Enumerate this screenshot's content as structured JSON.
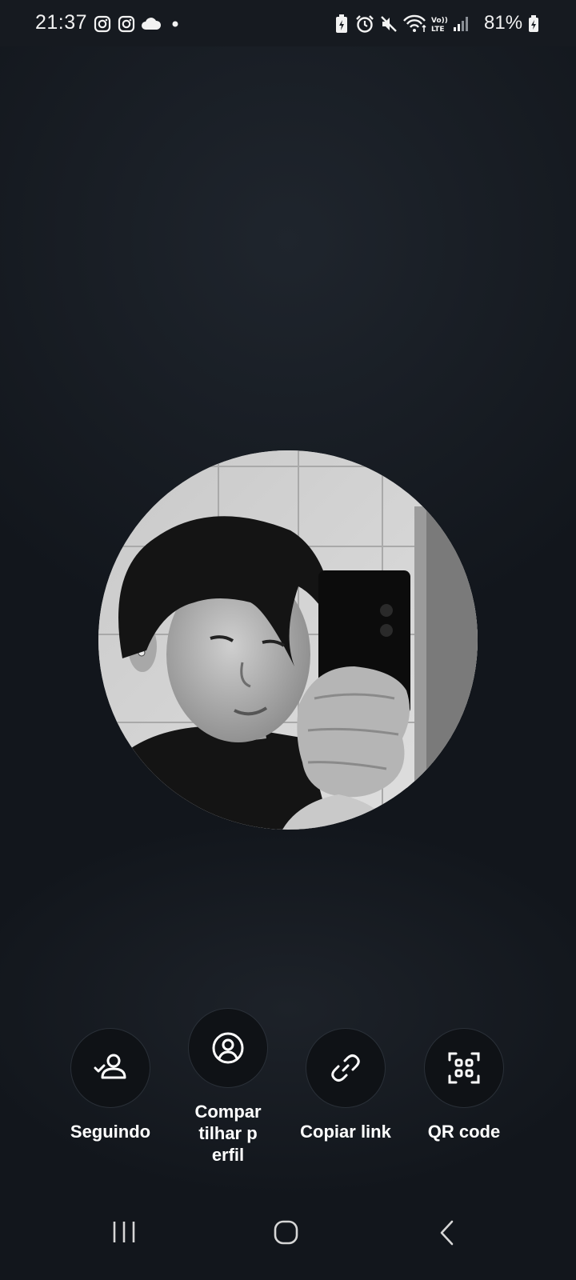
{
  "status_bar": {
    "time": "21:37",
    "battery": "81%",
    "icons": [
      "instagram-icon",
      "instagram-icon",
      "cloud-icon",
      "dot-icon",
      "battery-saver-icon",
      "alarm-icon",
      "mute-icon",
      "wifi-icon",
      "volte-icon",
      "signal-icon",
      "battery-charging-icon"
    ]
  },
  "profile": {
    "avatar_alt": "profile-photo"
  },
  "actions": {
    "following_label": "Seguindo",
    "share_label": "Compartilhar perfil",
    "copy_link_label": "Copiar link",
    "qr_label": "QR code"
  },
  "nav": {
    "icons": [
      "recent-apps-icon",
      "home-icon",
      "back-icon"
    ]
  },
  "colors": {
    "background": "#12161c",
    "button_bg": "#0f1216",
    "text": "#ffffff"
  }
}
